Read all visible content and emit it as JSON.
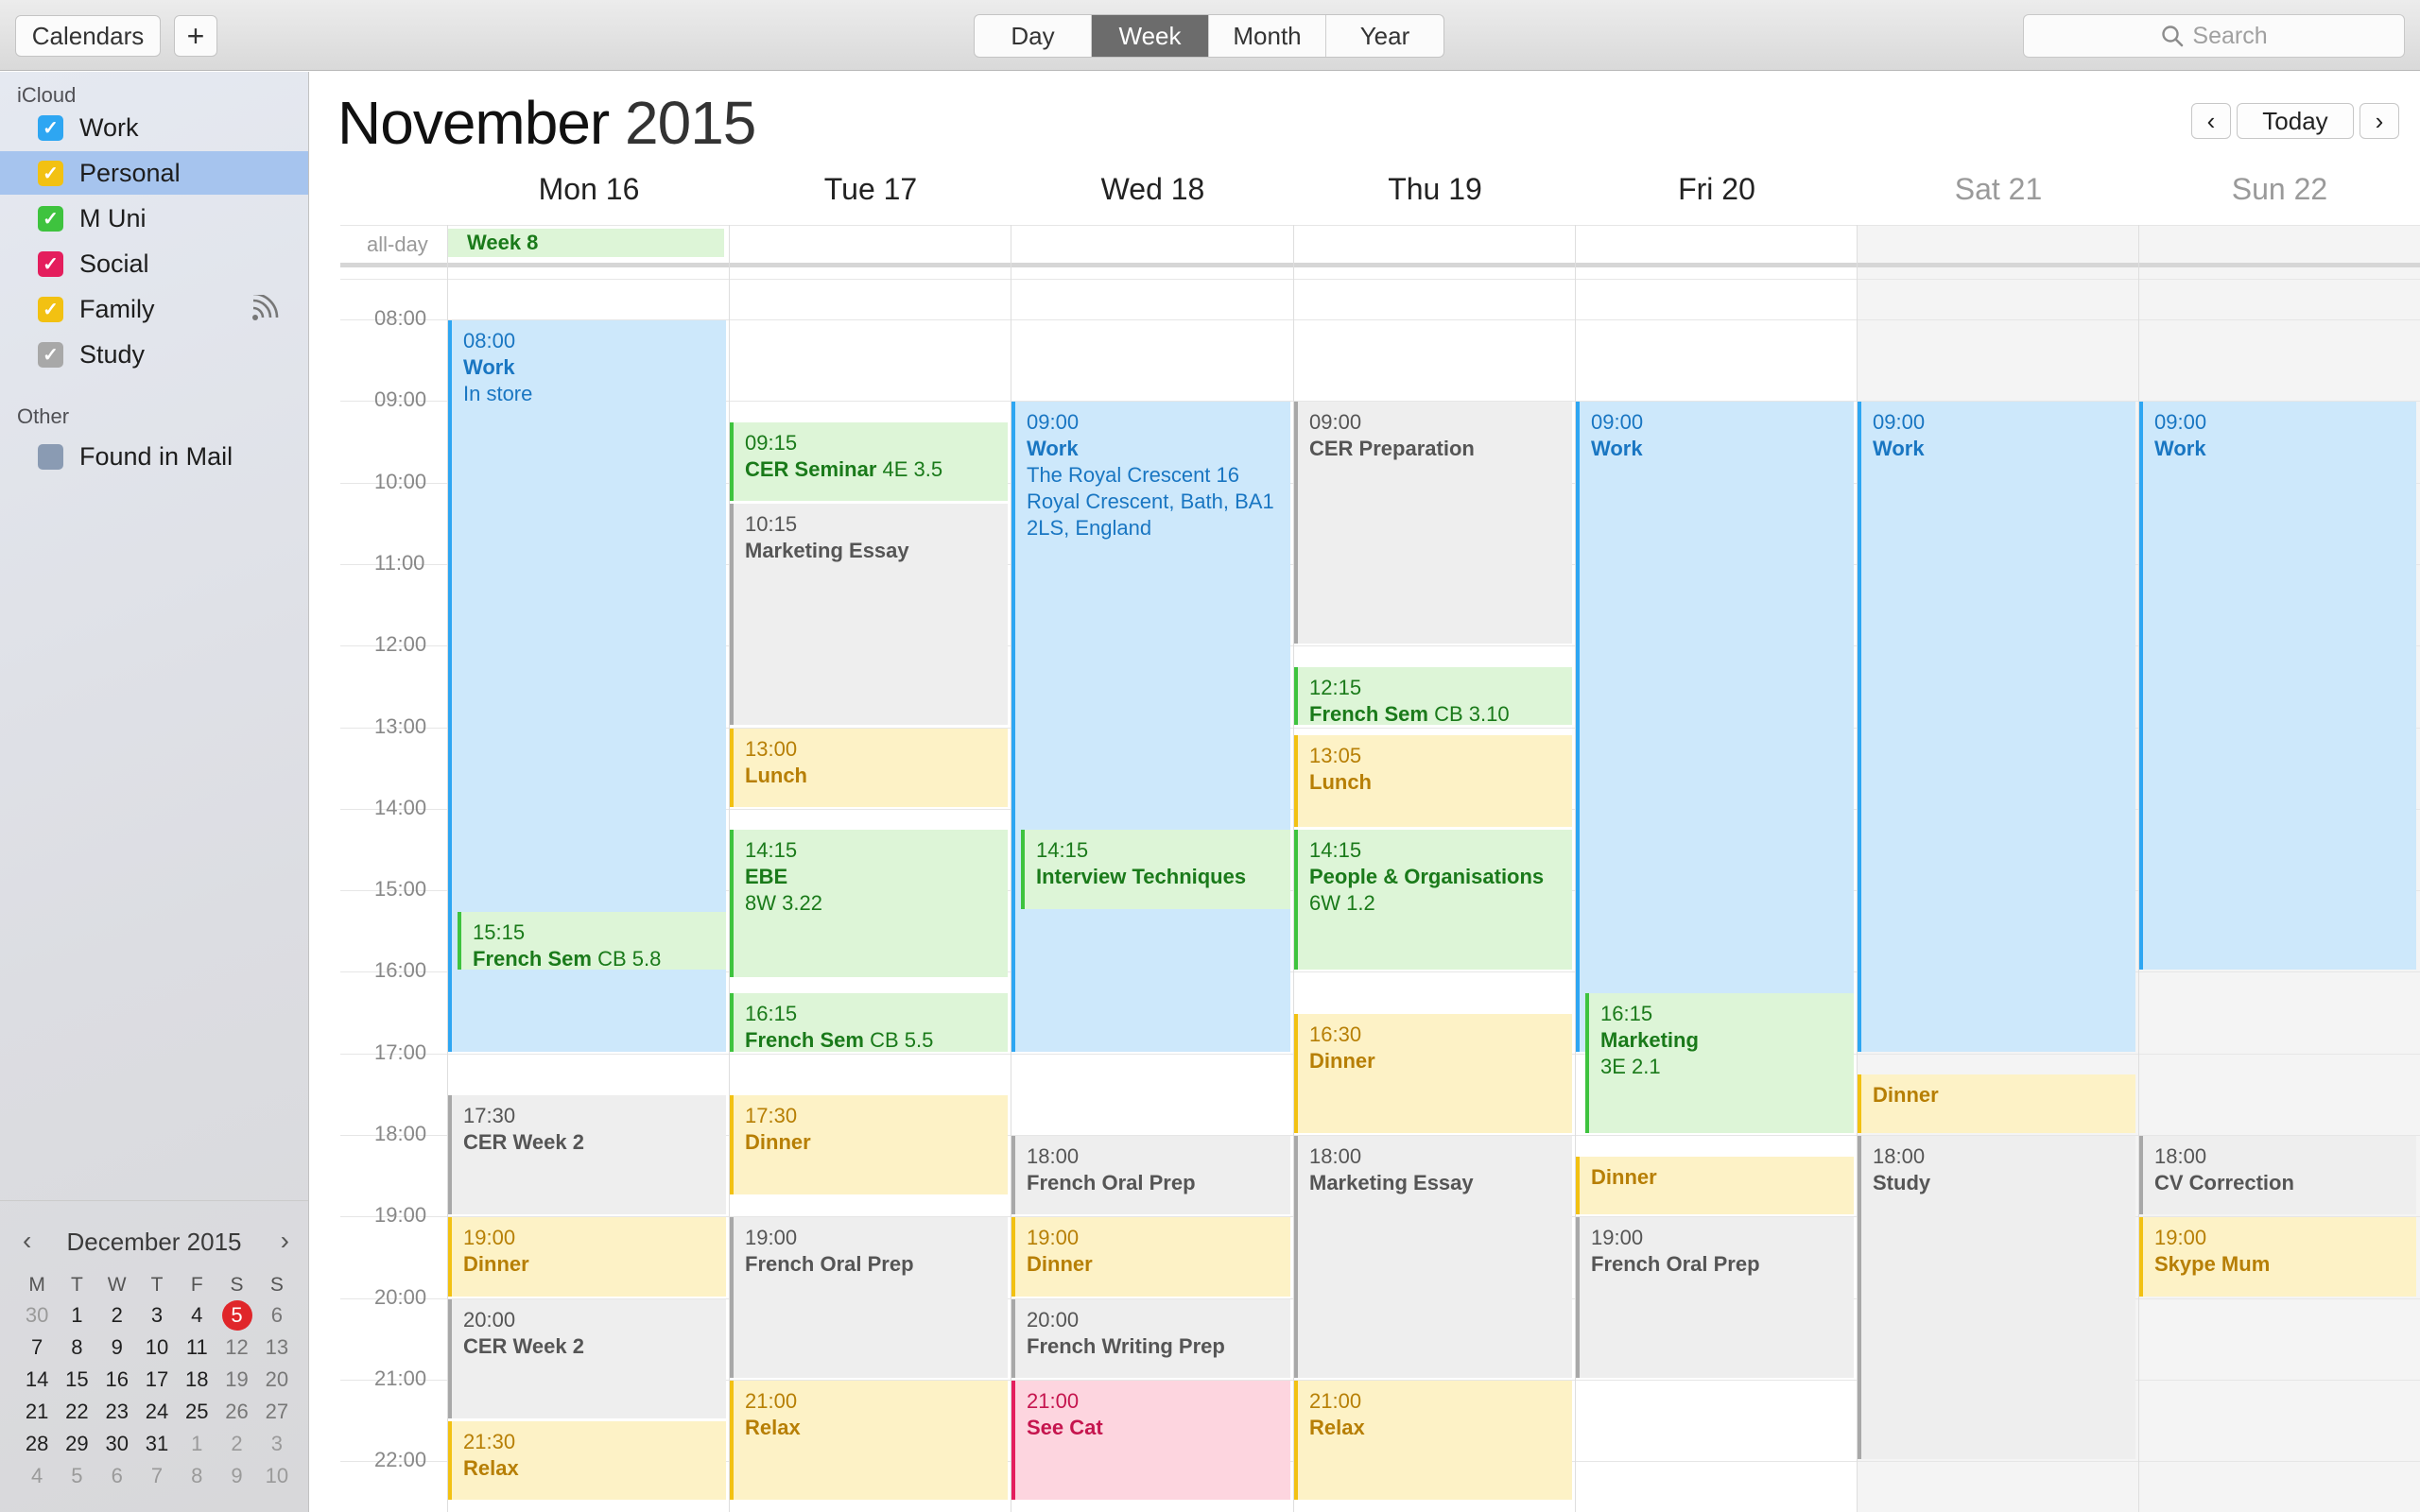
{
  "toolbar": {
    "calendars_label": "Calendars",
    "add_label": "+",
    "views": [
      "Day",
      "Week",
      "Month",
      "Year"
    ],
    "active_view": "Week",
    "search_placeholder": "Search"
  },
  "sidebar": {
    "icloud_header": "iCloud",
    "icloud_items": [
      {
        "label": "Work",
        "color": "#2ea6f2",
        "checked": true
      },
      {
        "label": "Personal",
        "color": "#f2c112",
        "checked": true,
        "selected": true
      },
      {
        "label": "M Uni",
        "color": "#3ec33e",
        "checked": true
      },
      {
        "label": "Social",
        "color": "#e41e5d",
        "checked": true
      },
      {
        "label": "Family",
        "color": "#f2c112",
        "checked": true,
        "shared": true
      },
      {
        "label": "Study",
        "color": "#a8a8a8",
        "checked": true
      }
    ],
    "other_header": "Other",
    "other_items": [
      {
        "label": "Found in Mail",
        "color": "#8a9bb3",
        "checked": false
      }
    ]
  },
  "mini_calendar": {
    "title": "December 2015",
    "weekday_headers": [
      "M",
      "T",
      "W",
      "T",
      "F",
      "S",
      "S"
    ],
    "today": "5",
    "weeks": [
      [
        "30",
        "1",
        "2",
        "3",
        "4",
        "5",
        "6"
      ],
      [
        "7",
        "8",
        "9",
        "10",
        "11",
        "12",
        "13"
      ],
      [
        "14",
        "15",
        "16",
        "17",
        "18",
        "19",
        "20"
      ],
      [
        "21",
        "22",
        "23",
        "24",
        "25",
        "26",
        "27"
      ],
      [
        "28",
        "29",
        "30",
        "31",
        "1",
        "2",
        "3"
      ],
      [
        "4",
        "5",
        "6",
        "7",
        "8",
        "9",
        "10"
      ]
    ]
  },
  "header": {
    "month": "November",
    "year": "2015",
    "today_label": "Today"
  },
  "days": [
    "Mon 16",
    "Tue 17",
    "Wed 18",
    "Thu 19",
    "Fri 20",
    "Sat 21",
    "Sun 22"
  ],
  "allday_label": "all-day",
  "allday_event": "Week 8",
  "hours": [
    "08:00",
    "09:00",
    "10:00",
    "11:00",
    "12:00",
    "13:00",
    "14:00",
    "15:00",
    "16:00",
    "17:00",
    "18:00",
    "19:00",
    "20:00",
    "21:00",
    "22:00"
  ],
  "events": [
    {
      "day": 0,
      "start": "08:00",
      "end": "17:00",
      "time": "08:00",
      "title": "Work",
      "location": "In store",
      "cal": "work"
    },
    {
      "day": 0,
      "start": "15:15",
      "end": "16:00",
      "time": "15:15",
      "title": "French Sem",
      "location": "CB 5.8",
      "inline": true,
      "cal": "uni",
      "indent": true
    },
    {
      "day": 0,
      "start": "17:30",
      "end": "19:00",
      "time": "17:30",
      "title": "CER Week 2",
      "cal": "study"
    },
    {
      "day": 0,
      "start": "19:00",
      "end": "20:00",
      "time": "19:00",
      "title": "Dinner",
      "cal": "pers"
    },
    {
      "day": 0,
      "start": "20:00",
      "end": "21:30",
      "time": "20:00",
      "title": "CER Week 2",
      "cal": "study"
    },
    {
      "day": 0,
      "start": "21:30",
      "end": "22:30",
      "time": "21:30",
      "title": "Relax",
      "cal": "pers"
    },
    {
      "day": 1,
      "start": "09:15",
      "end": "10:15",
      "time": "09:15",
      "title": "CER Seminar",
      "location": "4E 3.5",
      "inline": true,
      "cal": "uni"
    },
    {
      "day": 1,
      "start": "10:15",
      "end": "13:00",
      "time": "10:15",
      "title": "Marketing Essay",
      "cal": "study"
    },
    {
      "day": 1,
      "start": "13:00",
      "end": "14:00",
      "time": "13:00",
      "title": "Lunch",
      "cal": "pers"
    },
    {
      "day": 1,
      "start": "14:15",
      "end": "16:05",
      "time": "14:15",
      "title": "EBE",
      "location": "8W 3.22",
      "cal": "uni"
    },
    {
      "day": 1,
      "start": "16:15",
      "end": "17:00",
      "time": "16:15",
      "title": "French Sem",
      "location": "CB 5.5",
      "inline": true,
      "cal": "uni"
    },
    {
      "day": 1,
      "start": "17:30",
      "end": "18:45",
      "time": "17:30",
      "title": "Dinner",
      "cal": "pers"
    },
    {
      "day": 1,
      "start": "19:00",
      "end": "21:00",
      "time": "19:00",
      "title": "French Oral Prep",
      "cal": "study"
    },
    {
      "day": 1,
      "start": "21:00",
      "end": "22:30",
      "time": "21:00",
      "title": "Relax",
      "cal": "pers"
    },
    {
      "day": 2,
      "start": "09:00",
      "end": "17:00",
      "time": "09:00",
      "title": "Work",
      "location": "The Royal Crescent 16 Royal Crescent, Bath, BA1 2LS, England",
      "cal": "work"
    },
    {
      "day": 2,
      "start": "14:15",
      "end": "15:15",
      "time": "14:15",
      "title": "Interview Techniques",
      "cal": "uni",
      "indent": true
    },
    {
      "day": 2,
      "start": "18:00",
      "end": "19:00",
      "time": "18:00",
      "title": "French Oral Prep",
      "cal": "study"
    },
    {
      "day": 2,
      "start": "19:00",
      "end": "20:00",
      "time": "19:00",
      "title": "Dinner",
      "cal": "pers"
    },
    {
      "day": 2,
      "start": "20:00",
      "end": "21:00",
      "time": "20:00",
      "title": "French Writing Prep",
      "cal": "study"
    },
    {
      "day": 2,
      "start": "21:00",
      "end": "22:30",
      "time": "21:00",
      "title": "See Cat",
      "cal": "soc"
    },
    {
      "day": 3,
      "start": "09:00",
      "end": "12:00",
      "time": "09:00",
      "title": "CER Preparation",
      "cal": "study"
    },
    {
      "day": 3,
      "start": "12:15",
      "end": "13:00",
      "time": "12:15",
      "title": "French Sem",
      "location": "CB 3.10",
      "inline": true,
      "cal": "uni"
    },
    {
      "day": 3,
      "start": "13:05",
      "end": "14:15",
      "time": "13:05",
      "title": "Lunch",
      "cal": "pers"
    },
    {
      "day": 3,
      "start": "14:15",
      "end": "16:00",
      "time": "14:15",
      "title": "People & Organisations",
      "location": "6W 1.2",
      "cal": "uni"
    },
    {
      "day": 3,
      "start": "16:30",
      "end": "18:00",
      "time": "16:30",
      "title": "Dinner",
      "cal": "pers"
    },
    {
      "day": 3,
      "start": "18:00",
      "end": "21:00",
      "time": "18:00",
      "title": "Marketing Essay",
      "cal": "study"
    },
    {
      "day": 3,
      "start": "21:00",
      "end": "22:30",
      "time": "21:00",
      "title": "Relax",
      "cal": "pers"
    },
    {
      "day": 4,
      "start": "09:00",
      "end": "17:00",
      "time": "09:00",
      "title": "Work",
      "cal": "work"
    },
    {
      "day": 4,
      "start": "16:15",
      "end": "18:00",
      "time": "16:15",
      "title": "Marketing",
      "location": "3E 2.1",
      "cal": "uni",
      "indent": true
    },
    {
      "day": 4,
      "start": "18:15",
      "end": "19:00",
      "time": "",
      "title": "Dinner",
      "cal": "pers"
    },
    {
      "day": 4,
      "start": "19:00",
      "end": "21:00",
      "time": "19:00",
      "title": "French Oral Prep",
      "cal": "study"
    },
    {
      "day": 5,
      "start": "09:00",
      "end": "17:00",
      "time": "09:00",
      "title": "Work",
      "cal": "work"
    },
    {
      "day": 5,
      "start": "17:15",
      "end": "18:00",
      "time": "",
      "title": "Dinner",
      "cal": "pers"
    },
    {
      "day": 5,
      "start": "18:00",
      "end": "22:00",
      "time": "18:00",
      "title": "Study",
      "cal": "study"
    },
    {
      "day": 6,
      "start": "09:00",
      "end": "16:00",
      "time": "09:00",
      "title": "Work",
      "cal": "work"
    },
    {
      "day": 6,
      "start": "18:00",
      "end": "19:00",
      "time": "18:00",
      "title": "CV Correction",
      "cal": "study"
    },
    {
      "day": 6,
      "start": "19:00",
      "end": "20:00",
      "time": "19:00",
      "title": "Skype Mum",
      "cal": "pers"
    }
  ]
}
